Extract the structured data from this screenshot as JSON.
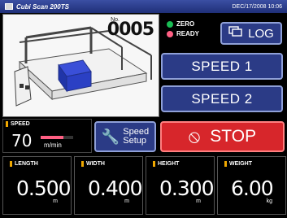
{
  "titlebar": {
    "title": "Cubi Scan 200TS",
    "datetime": "DEC/17/2008 10:06"
  },
  "viewport": {
    "counter_label": "No.",
    "counter": "0005"
  },
  "status": {
    "zero": "ZERO",
    "ready": "READY",
    "zero_color": "#1abc54",
    "ready_color": "#ff5f83"
  },
  "buttons": {
    "log": "LOG",
    "speed1": "SPEED 1",
    "speed2": "SPEED 2",
    "setup_line1": "Speed",
    "setup_line2": "Setup",
    "stop": "STOP"
  },
  "speed": {
    "label": "SPEED",
    "value": "70",
    "unit": "m/min",
    "level": 0.7
  },
  "measurements": [
    {
      "label": "LENGTH",
      "value": "0.500",
      "unit": "m"
    },
    {
      "label": "WIDTH",
      "value": "0.400",
      "unit": "m"
    },
    {
      "label": "HEIGHT",
      "value": "0.300",
      "unit": "m"
    },
    {
      "label": "WEIGHT",
      "value": "6.00",
      "unit": "kg"
    }
  ],
  "colors": {
    "accent": "#2b3b86",
    "stop": "#d7262b",
    "label_mark": "#f0a800"
  },
  "icons": {
    "log": "window-stack-icon",
    "setup": "wrench-icon",
    "stop": "no-entry-icon"
  }
}
